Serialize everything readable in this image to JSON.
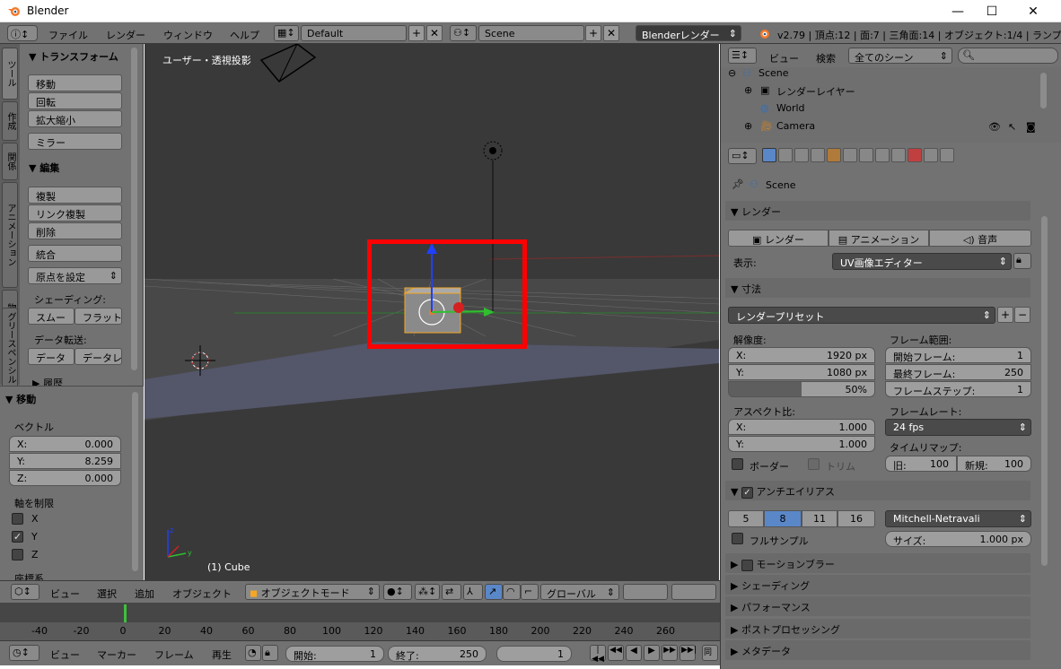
{
  "window": {
    "title": "Blender"
  },
  "top_menu": {
    "items": [
      "ファイル",
      "レンダー",
      "ウィンドウ",
      "ヘルプ"
    ],
    "layout": "Default",
    "scene": "Scene",
    "engine": "Blenderレンダー",
    "status": "v2.79 | 頂点:12 | 面:7 | 三角面:14 | オブジェクト:1/4 | ランプ"
  },
  "tool_tabs": [
    "ツール",
    "作成",
    "関係",
    "アニメーション",
    "物理演算",
    "グリースペンシル"
  ],
  "tool_shelf": {
    "transform_header": "▼ トランスフォーム",
    "transform_buttons": [
      "移動",
      "回転",
      "拡大縮小"
    ],
    "mirror": "ミラー",
    "edit_header": "▼ 編集",
    "edit_buttons": [
      "複製",
      "リンク複製",
      "削除"
    ],
    "join": "統合",
    "set_origin": "原点を設定",
    "shading_label": "シェーディング:",
    "smooth": "スムー",
    "flat": "フラット",
    "data_transfer_label": "データ転送:",
    "data": "データ",
    "data_layout": "データレ",
    "history_header": "▶ 履歴"
  },
  "operator_panel": {
    "header": "▼ 移動",
    "vector_label": "ベクトル",
    "x_label": "X:",
    "x_value": "0.000",
    "y_label": "Y:",
    "y_value": "8.259",
    "z_label": "Z:",
    "z_value": "0.000",
    "constraint_label": "軸を制限",
    "axis_x": "X",
    "axis_y": "Y",
    "axis_z": "Z",
    "constraint_y_checked": true,
    "orientation_label": "座標系"
  },
  "viewport": {
    "view_label": "ユーザー・透視投影",
    "object_label": "(1) Cube",
    "highlight_color": "#ff0000"
  },
  "viewport_header": {
    "menus": [
      "ビュー",
      "選択",
      "追加",
      "オブジェクト"
    ],
    "mode": "オブジェクトモード",
    "orientation": "グローバル"
  },
  "timeline": {
    "ticks": [
      "-40",
      "-20",
      "0",
      "20",
      "40",
      "60",
      "80",
      "100",
      "120",
      "140",
      "160",
      "180",
      "200",
      "220",
      "240",
      "260"
    ],
    "current_frame": 1
  },
  "timeline_header": {
    "menus": [
      "ビュー",
      "マーカー",
      "フレーム",
      "再生"
    ],
    "start_label": "開始:",
    "start_value": "1",
    "end_label": "終了:",
    "end_value": "250",
    "current_value": "1"
  },
  "outliner": {
    "menus": [
      "ビュー",
      "検索"
    ],
    "filter": "全てのシーン",
    "items": [
      "Scene",
      "レンダーレイヤー",
      "World",
      "Camera"
    ]
  },
  "properties": {
    "context": "Scene",
    "render_header": "▼ レンダー",
    "render_btn": "レンダー",
    "animation_btn": "アニメーション",
    "audio_btn": "音声",
    "display_label": "表示:",
    "display_value": "UV画像エディター",
    "dimensions_header": "▼ 寸法",
    "preset": "レンダープリセット",
    "resolution_label": "解像度:",
    "res_x_label": "X:",
    "res_x": "1920 px",
    "res_y_label": "Y:",
    "res_y": "1080 px",
    "res_pct": "50%",
    "res_pct_value": 0.5,
    "frame_range_label": "フレーム範囲:",
    "start_frame_label": "開始フレーム:",
    "start_frame": "1",
    "end_frame_label": "最終フレーム:",
    "end_frame": "250",
    "frame_step_label": "フレームステップ:",
    "frame_step": "1",
    "aspect_label": "アスペクト比:",
    "asp_x_label": "X:",
    "asp_x": "1.000",
    "asp_y_label": "Y:",
    "asp_y": "1.000",
    "frame_rate_label": "フレームレート:",
    "frame_rate": "24 fps",
    "border_label": "ボーダー",
    "crop_label": "トリム",
    "time_remap_label": "タイムリマップ:",
    "old_label": "旧:",
    "old_value": "100",
    "new_label": "新規:",
    "new_value": "100",
    "aa_header": "アンチエイリアス",
    "aa_samples": [
      "5",
      "8",
      "11",
      "16"
    ],
    "aa_selected": "8",
    "aa_filter": "Mitchell-Netravali",
    "full_sample": "フルサンプル",
    "size_label": "サイズ:",
    "size_value": "1.000 px",
    "motion_blur": "モーションブラー",
    "shading": "▶ シェーディング",
    "performance": "▶ パフォーマンス",
    "post_processing": "▶ ポストプロセッシング",
    "metadata": "▶ メタデータ"
  }
}
